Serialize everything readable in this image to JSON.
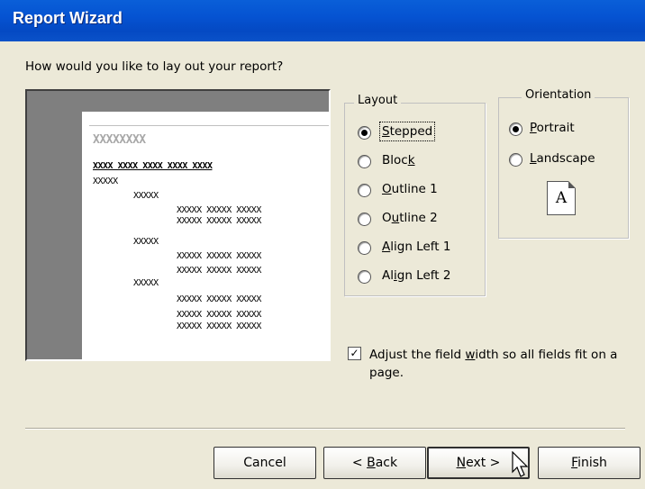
{
  "window": {
    "title": "Report Wizard"
  },
  "question": "How would you like to lay out your report?",
  "preview": {
    "title_placeholder": "XXXXXXXX",
    "header_row": "XXXX  XXXX  XXXX  XXXX  XXXX",
    "group_level_1": "XXXXX",
    "group_level_2a": "XXXXX",
    "group_level_2b": "XXXXX",
    "group_level_2c": "XXXXX",
    "detail_row": "XXXXX  XXXXX  XXXXX"
  },
  "layout_group": {
    "title": "Layout",
    "selected": "Stepped",
    "options": [
      {
        "pre": "",
        "key": "S",
        "post": "tepped"
      },
      {
        "pre": "Bloc",
        "key": "k",
        "post": ""
      },
      {
        "pre": "",
        "key": "O",
        "post": "utline 1"
      },
      {
        "pre": "O",
        "key": "u",
        "post": "tline 2"
      },
      {
        "pre": "",
        "key": "A",
        "post": "lign Left 1"
      },
      {
        "pre": "Al",
        "key": "i",
        "post": "gn Left 2"
      }
    ]
  },
  "orientation_group": {
    "title": "Orientation",
    "selected": "Portrait",
    "options": [
      {
        "pre": "",
        "key": "P",
        "post": "ortrait"
      },
      {
        "pre": "",
        "key": "L",
        "post": "andscape"
      }
    ],
    "icon_letter": "A"
  },
  "adjust_width": {
    "checked": true,
    "check_glyph": "✓",
    "pre": "Adjust the field ",
    "key": "w",
    "post": "idth so all fields fit on a page."
  },
  "buttons": {
    "cancel": "Cancel",
    "back": {
      "pre": "< ",
      "key": "B",
      "post": "ack"
    },
    "next": {
      "pre": "",
      "key": "N",
      "post": "ext >"
    },
    "finish": {
      "pre": "",
      "key": "F",
      "post": "inish"
    }
  }
}
